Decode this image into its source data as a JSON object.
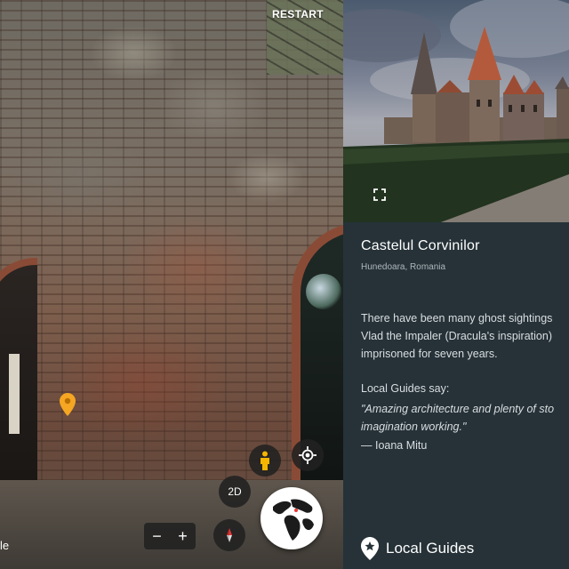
{
  "street_view": {
    "restart_label": "RESTART",
    "zoom_out_label": "−",
    "zoom_in_label": "+",
    "mode_label": "2D",
    "logo_fragment": "le",
    "icons": [
      "location-pin-icon",
      "pegman-icon",
      "my-location-icon",
      "compass-icon",
      "globe-icon"
    ],
    "pin_color": "#f5a623"
  },
  "info_panel": {
    "title": "Castelul Corvinilor",
    "subtitle": "Hunedoara, Romania",
    "description_lines": [
      "There have been many ghost sightings",
      "Vlad the Impaler (Dracula's inspiration)",
      "imprisoned for seven years."
    ],
    "local_guides_heading": "Local Guides say:",
    "quote_lines": [
      "\"Amazing architecture and plenty of sto",
      "imagination working.\""
    ],
    "quote_author": "— Ioana Mitu",
    "footer_label": "Local Guides",
    "icons": [
      "fullscreen-icon",
      "local-guides-icon"
    ],
    "background_color": "#263238"
  }
}
